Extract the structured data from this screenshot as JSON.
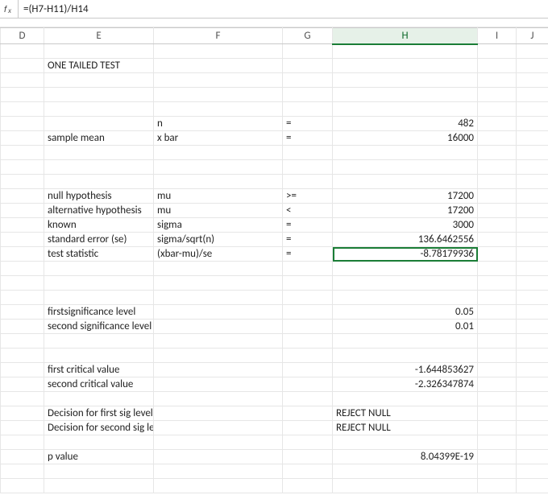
{
  "formula_bar": {
    "value": "=(H7-H11)/H14"
  },
  "fx_label": "fx",
  "columns": [
    "D",
    "E",
    "F",
    "G",
    "H",
    "I",
    "J"
  ],
  "active_column": "H",
  "rows": [
    {},
    {
      "E": "ONE TAILED TEST"
    },
    {},
    {},
    {},
    {
      "F": "n",
      "G": "=",
      "H_num": "482"
    },
    {
      "E": "sample mean",
      "F": "x bar",
      "G": "=",
      "H_num": "16000"
    },
    {},
    {},
    {},
    {
      "E": "null hypothesis",
      "F": "mu",
      "G": ">=",
      "H_num": "17200"
    },
    {
      "E_spill": "alternative hypothesis",
      "E": "alternative hypothe",
      "F": "mu",
      "G": "<",
      "H_num": "17200"
    },
    {
      "E": "known",
      "F": "sigma",
      "G": "=",
      "H_num": "3000"
    },
    {
      "E": "standard error (se)",
      "F": "sigma/sqrt(n)",
      "G": "=",
      "H_num": "136.6462556"
    },
    {
      "E": "test statistic",
      "F": "(xbar-mu)/se",
      "G": "=",
      "H_num": "-8.78179936",
      "H_selected": true
    },
    {},
    {},
    {},
    {
      "E_spill": "firstsignificance level",
      "H_num": "0.05"
    },
    {
      "E_spill": "second significance level",
      "H_num": "0.01"
    },
    {},
    {},
    {
      "E_spill": "first critical value",
      "H_num": "-1.644853627"
    },
    {
      "E_spill": "second critical value",
      "H_num": "-2.326347874"
    },
    {},
    {
      "E_spill": "Decision for first sig level",
      "H_txt": "REJECT NULL"
    },
    {
      "E_spill": "Decision for second sig level",
      "H_txt": "REJECT NULL"
    },
    {},
    {
      "E": "p value",
      "H_num": "8.04399E-19"
    },
    {},
    {}
  ],
  "chart_data": {
    "type": "table",
    "title": "ONE TAILED TEST",
    "parameters": [
      {
        "label": "n",
        "symbol": "n",
        "op": "=",
        "value": 482
      },
      {
        "label": "sample mean",
        "symbol": "x bar",
        "op": "=",
        "value": 16000
      },
      {
        "label": "null hypothesis",
        "symbol": "mu",
        "op": ">=",
        "value": 17200
      },
      {
        "label": "alternative hypothesis",
        "symbol": "mu",
        "op": "<",
        "value": 17200
      },
      {
        "label": "known",
        "symbol": "sigma",
        "op": "=",
        "value": 3000
      },
      {
        "label": "standard error (se)",
        "symbol": "sigma/sqrt(n)",
        "op": "=",
        "value": 136.6462556
      },
      {
        "label": "test statistic",
        "symbol": "(xbar-mu)/se",
        "op": "=",
        "value": -8.78179936
      },
      {
        "label": "firstsignificance level",
        "value": 0.05
      },
      {
        "label": "second significance level",
        "value": 0.01
      },
      {
        "label": "first critical value",
        "value": -1.644853627
      },
      {
        "label": "second critical value",
        "value": -2.326347874
      },
      {
        "label": "Decision for first sig level",
        "value": "REJECT NULL"
      },
      {
        "label": "Decision for second sig level",
        "value": "REJECT NULL"
      },
      {
        "label": "p value",
        "value": 8.04399e-19
      }
    ]
  }
}
